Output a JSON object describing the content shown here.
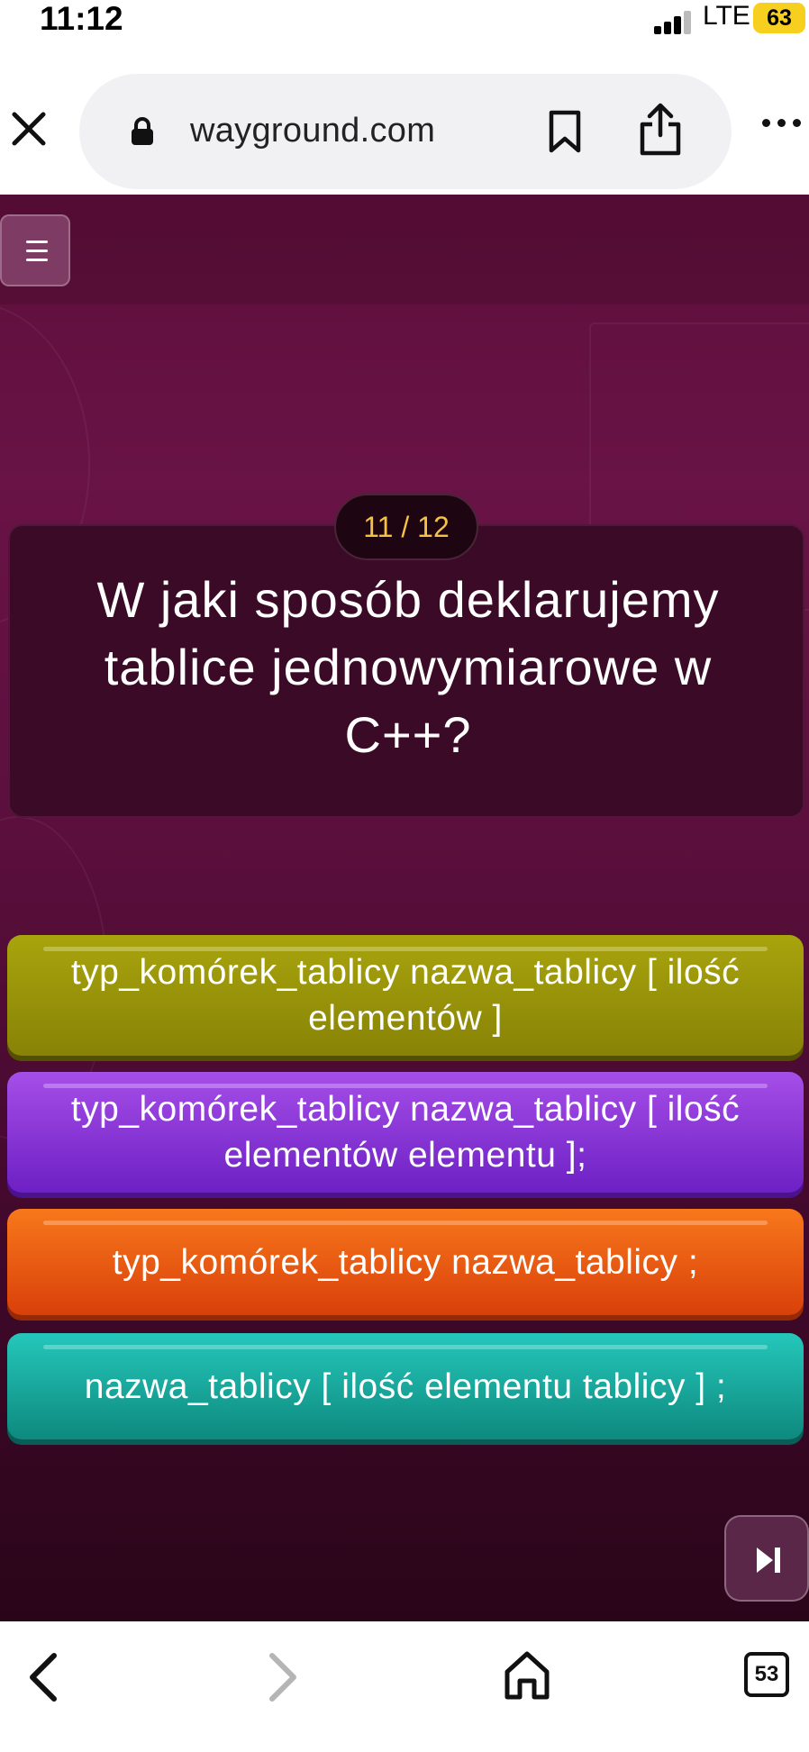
{
  "status_bar": {
    "time": "11:12",
    "network": "LTE",
    "battery": "63",
    "battery_color": "#f7cf1f"
  },
  "browser": {
    "url": "wayground.com",
    "icons": [
      "close-icon",
      "lock-icon",
      "bookmark-icon",
      "share-icon",
      "more-icon"
    ]
  },
  "quiz": {
    "counter": "11 / 12",
    "question": "W jaki sposób deklarujemy tablice jednowymiarowe w C++?",
    "answers": [
      {
        "text": "typ_komórek_tablicy nazwa_tablicy [ ilość elementów ]",
        "color": "#9c980a"
      },
      {
        "text": "typ_komórek_tablicy nazwa_tablicy [ ilość elementów elementu ];",
        "color": "#8a36d8"
      },
      {
        "text": "typ_komórek_tablicy nazwa_tablicy ;",
        "color": "#ec5a12"
      },
      {
        "text": "nazwa_tablicy [ ilość elementu tablicy ] ;",
        "color": "#19aa9e"
      }
    ],
    "background_color": "#5d0f3a",
    "counter_color": "#f5c242"
  },
  "bottom_bar": {
    "tabs_count": "53",
    "icons": [
      "back-icon",
      "forward-icon",
      "home-icon",
      "tabs-icon"
    ]
  }
}
